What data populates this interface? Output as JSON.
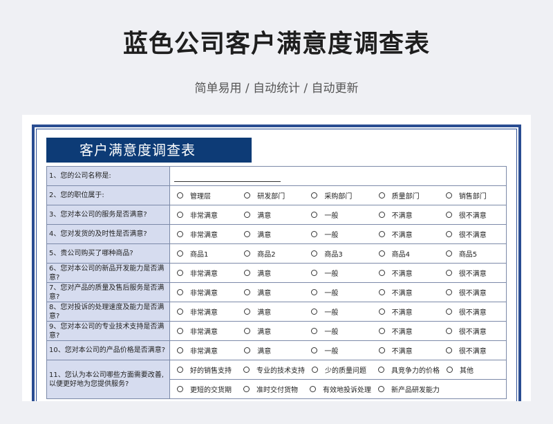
{
  "title": "蓝色公司客户满意度调查表",
  "subtitle": "简单易用 / 自动统计 / 自动更新",
  "form_header": "客户满意度调查表",
  "questions": [
    {
      "label": "1、您的公司名称是:",
      "options": []
    },
    {
      "label": "2、您的职位属于:",
      "options": [
        "管理层",
        "研发部门",
        "采购部门",
        "质量部门",
        "销售部门"
      ]
    },
    {
      "label": "3、您对本公司的服务是否满意?",
      "options": [
        "非常满意",
        "满意",
        "一般",
        "不满意",
        "很不满意"
      ]
    },
    {
      "label": "4、您对发货的及时性是否满意?",
      "options": [
        "非常满意",
        "满意",
        "一般",
        "不满意",
        "很不满意"
      ]
    },
    {
      "label": "5、贵公司购买了哪种商品?",
      "options": [
        "商品1",
        "商品2",
        "商品3",
        "商品4",
        "商品5"
      ]
    },
    {
      "label": "6、您对本公司的新品开发能力是否满意?",
      "options": [
        "非常满意",
        "满意",
        "一般",
        "不满意",
        "很不满意"
      ]
    },
    {
      "label": "7、您对产品的质量及售后服务是否满意?",
      "options": [
        "非常满意",
        "满意",
        "一般",
        "不满意",
        "很不满意"
      ]
    },
    {
      "label": "8、您对投诉的处理速度及能力是否满意?",
      "options": [
        "非常满意",
        "满意",
        "一般",
        "不满意",
        "很不满意"
      ]
    },
    {
      "label": "9、您对本公司的专业技术支持是否满意?",
      "options": [
        "非常满意",
        "满意",
        "一般",
        "不满意",
        "很不满意"
      ]
    },
    {
      "label": "10、您对本公司的产品价格是否满意?",
      "options": [
        "非常满意",
        "满意",
        "一般",
        "不满意",
        "很不满意"
      ]
    }
  ],
  "q11": {
    "label": "11、您认为本公司哪些方面需要改善,以便更好地为您提供服务?",
    "row1": [
      "好的销售支持",
      "专业的技术支持",
      "少的质量问题",
      "具竞争力的价格",
      "其他"
    ],
    "row2": [
      "更短的交货期",
      "准时交付货物",
      "有效地投诉处理",
      "新产品研发能力",
      ""
    ]
  }
}
